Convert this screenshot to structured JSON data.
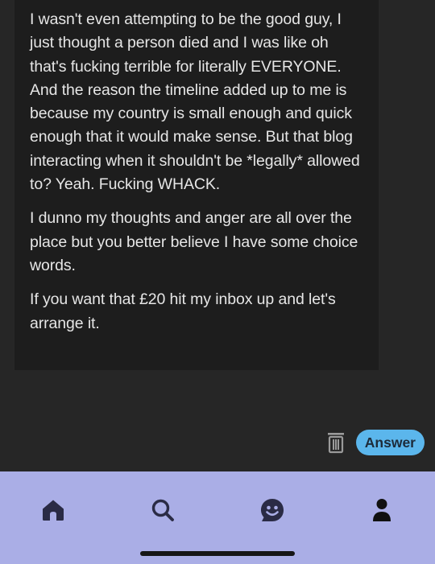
{
  "message": {
    "paragraphs": [
      "I wasn't even attempting to be the good guy, I just thought a person died and I was like oh that's fucking terrible for literally EVERYONE. And the reason the timeline added up to me is because my country is small enough and quick enough that it would make sense. But that blog interacting when it shouldn't be *legally* allowed to? Yeah. Fucking WHACK.",
      "I dunno my thoughts and anger are all over the place but you better believe I have some choice words.",
      "If you want that £20 hit my inbox up and let's arrange it."
    ]
  },
  "actions": {
    "delete_icon": "trash-icon",
    "answer_label": "Answer"
  },
  "nav": {
    "items": [
      {
        "icon": "home-icon"
      },
      {
        "icon": "search-icon"
      },
      {
        "icon": "smiley-icon"
      },
      {
        "icon": "account-icon"
      }
    ]
  },
  "colors": {
    "background": "#262626",
    "card": "#1d1d1d",
    "text": "#e6e6e6",
    "accent": "#5bb6ec",
    "nav_background": "#aaaee6",
    "nav_icon": "#2a2b45"
  }
}
